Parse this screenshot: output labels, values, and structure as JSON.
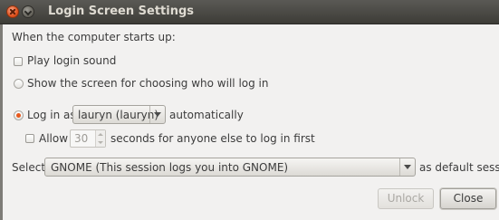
{
  "window": {
    "title": "Login Screen Settings"
  },
  "heading": "When the computer starts up:",
  "options": {
    "play_sound": {
      "label": "Play login sound",
      "checked": false
    },
    "show_chooser": {
      "label": "Show the screen for choosing who will log in",
      "selected": false
    },
    "login_as": {
      "prefix": "Log in as",
      "user": "lauryn (lauryn)",
      "suffix": "automatically",
      "selected": true
    },
    "allow": {
      "label": "Allow",
      "seconds": "30",
      "suffix": "seconds for anyone else to log in first",
      "checked": false
    }
  },
  "session": {
    "prefix": "Select",
    "value": "GNOME (This session logs you into GNOME)",
    "suffix": "as default session"
  },
  "buttons": {
    "unlock": "Unlock",
    "close": "Close"
  },
  "colors": {
    "radio_selected": "#e8581c",
    "titlebar": "#3d3c37"
  }
}
